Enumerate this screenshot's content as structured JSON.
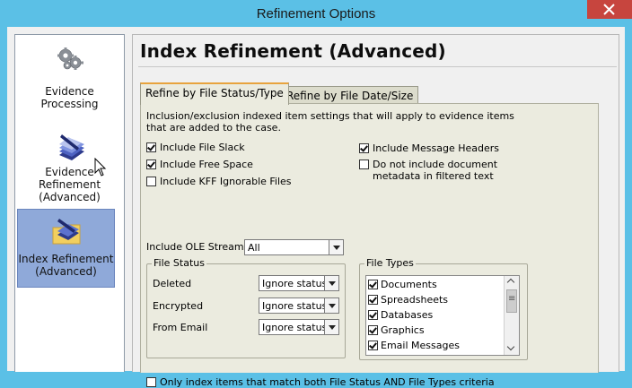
{
  "window": {
    "title": "Refinement Options"
  },
  "sidebar": {
    "items": [
      {
        "label_line1": "Evidence",
        "label_line2": "Processing",
        "label_line3": "",
        "icon": "gears-icon",
        "selected": false
      },
      {
        "label_line1": "Evidence",
        "label_line2": "Refinement",
        "label_line3": "(Advanced)",
        "icon": "pen-stack-icon",
        "selected": false
      },
      {
        "label_line1": "Index Refinement",
        "label_line2": "(Advanced)",
        "label_line3": "",
        "icon": "pen-folder-icon",
        "selected": true
      }
    ]
  },
  "main": {
    "heading": "Index Refinement (Advanced)",
    "tabs": [
      {
        "label": "Refine by File Status/Type",
        "active": true
      },
      {
        "label": "Refine by File Date/Size",
        "active": false
      }
    ],
    "description": "Inclusion/exclusion indexed item settings that will apply to evidence items that are added to the case.",
    "options_left": [
      {
        "label": "Include File Slack",
        "checked": true
      },
      {
        "label": "Include Free Space",
        "checked": true
      },
      {
        "label": "Include KFF Ignorable Files",
        "checked": false
      }
    ],
    "options_right": [
      {
        "label": "Include Message Headers",
        "checked": true
      },
      {
        "label": "Do not include document metadata in filtered text",
        "checked": false
      }
    ],
    "ole": {
      "label": "Include OLE Streams:",
      "value": "All"
    },
    "file_status": {
      "title": "File Status",
      "rows": [
        {
          "label": "Deleted",
          "value": "Ignore status"
        },
        {
          "label": "Encrypted",
          "value": "Ignore status"
        },
        {
          "label": "From Email",
          "value": "Ignore status"
        }
      ]
    },
    "file_types": {
      "title": "File Types",
      "items": [
        {
          "label": "Documents",
          "checked": true
        },
        {
          "label": "Spreadsheets",
          "checked": true
        },
        {
          "label": "Databases",
          "checked": true
        },
        {
          "label": "Graphics",
          "checked": true
        },
        {
          "label": "Email Messages",
          "checked": true
        }
      ]
    },
    "match_both": {
      "label": "Only index items that match both File Status AND File Types criteria",
      "checked": false
    }
  },
  "colors": {
    "titlebar": "#5bc0e6",
    "close": "#c7453e",
    "selected_nav": "#8fa9d9",
    "tab_accent": "#e8a33d"
  }
}
